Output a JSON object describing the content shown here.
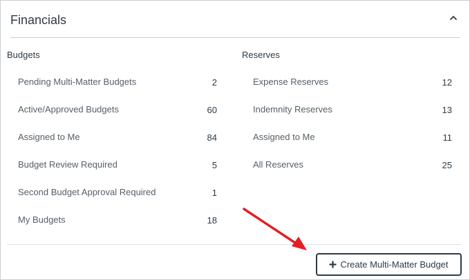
{
  "panel": {
    "title": "Financials",
    "collapse_icon": "chevron-up-icon"
  },
  "budgets": {
    "heading": "Budgets",
    "items": [
      {
        "label": "Pending Multi-Matter Budgets",
        "count": "2"
      },
      {
        "label": "Active/Approved Budgets",
        "count": "60"
      },
      {
        "label": "Assigned to Me",
        "count": "84"
      },
      {
        "label": "Budget Review Required",
        "count": "5"
      },
      {
        "label": "Second Budget Approval Required",
        "count": "1"
      },
      {
        "label": "My Budgets",
        "count": "18"
      }
    ]
  },
  "reserves": {
    "heading": "Reserves",
    "items": [
      {
        "label": "Expense Reserves",
        "count": "12"
      },
      {
        "label": "Indemnity Reserves",
        "count": "13"
      },
      {
        "label": "Assigned to Me",
        "count": "11"
      },
      {
        "label": "All Reserves",
        "count": "25"
      }
    ]
  },
  "actions": {
    "create_label": "Create Multi-Matter Budget",
    "create_icon": "plus-icon"
  },
  "colors": {
    "text": "#2d3b45",
    "muted_text": "#565f66",
    "border": "#c7cdd1",
    "annotation_arrow": "#e31e24"
  }
}
